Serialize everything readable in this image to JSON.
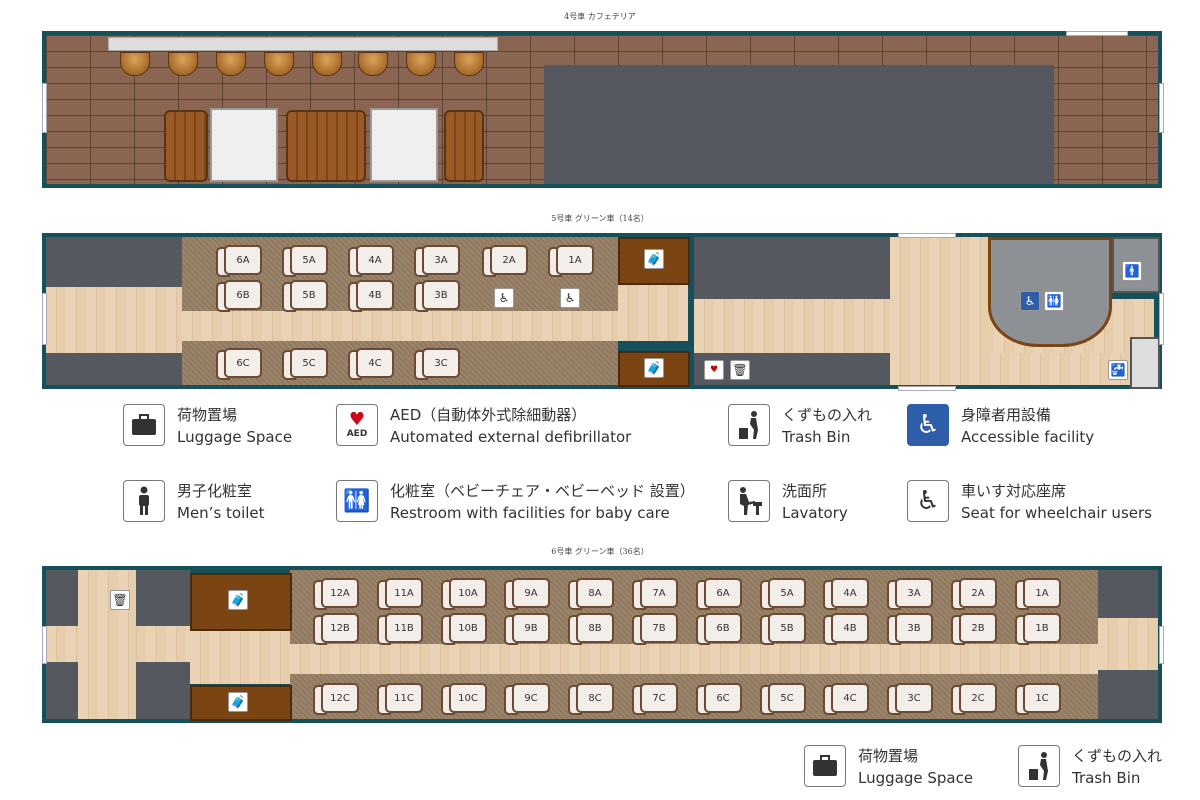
{
  "captions": {
    "car4": "4号車 カフェテリア",
    "car5": "5号車 グリーン車（14名）",
    "car6": "6号車 グリーン車（36名）"
  },
  "car5": {
    "seats_top_a": [
      "6A",
      "5A",
      "4A",
      "3A",
      "2A",
      "1A"
    ],
    "seats_top_b": [
      "6B",
      "5B",
      "4B",
      "3B"
    ],
    "seats_bottom_c": [
      "6C",
      "5C",
      "4C",
      "3C"
    ]
  },
  "car6": {
    "seats_a": [
      "12A",
      "11A",
      "10A",
      "9A",
      "8A",
      "7A",
      "6A",
      "5A",
      "4A",
      "3A",
      "2A",
      "1A"
    ],
    "seats_b": [
      "12B",
      "11B",
      "10B",
      "9B",
      "8B",
      "7B",
      "6B",
      "5B",
      "4B",
      "3B",
      "2B",
      "1B"
    ],
    "seats_c": [
      "12C",
      "11C",
      "10C",
      "9C",
      "8C",
      "7C",
      "6C",
      "5C",
      "4C",
      "3C",
      "2C",
      "1C"
    ]
  },
  "legend": {
    "luggage": {
      "ja": "荷物置場",
      "en": "Luggage Space"
    },
    "aed": {
      "ja": "AED（自動体外式除細動器）",
      "en": "Automated external defibrillator"
    },
    "trash": {
      "ja": "くずもの入れ",
      "en": "Trash Bin"
    },
    "accessible": {
      "ja": "身障者用設備",
      "en": "Accessible facility"
    },
    "mens": {
      "ja": "男子化粧室",
      "en": "Men’s toilet"
    },
    "restroom": {
      "ja": "化粧室（ベビーチェア・ベビーベッド 設置）",
      "en": "Restroom with facilities for baby care"
    },
    "lavatory": {
      "ja": "洗面所",
      "en": "Lavatory"
    },
    "wheelchair": {
      "ja": "車いす対応座席",
      "en": "Seat for wheelchair users"
    }
  },
  "legend2": {
    "luggage": {
      "ja": "荷物置場",
      "en": "Luggage Space"
    },
    "trash": {
      "ja": "くずもの入れ",
      "en": "Trash Bin"
    }
  },
  "aed_label": "AED",
  "icons": [
    "luggage-icon",
    "aed-icon",
    "trash-icon",
    "accessible-icon",
    "mens-toilet-icon",
    "restroom-icon",
    "lavatory-icon",
    "wheelchair-icon"
  ],
  "colors": {
    "car_border": "#16505a",
    "accessible_blue": "#2f5ea8",
    "luggage_brown": "#7a4512"
  }
}
